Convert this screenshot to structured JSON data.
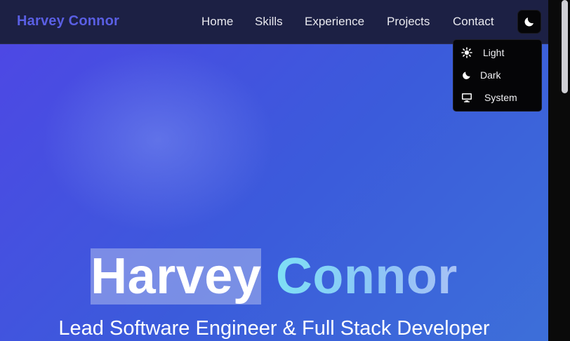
{
  "nav": {
    "brand": "Harvey Connor",
    "links": [
      "Home",
      "Skills",
      "Experience",
      "Projects",
      "Contact"
    ],
    "theme_icon": "moon-icon"
  },
  "theme_menu": {
    "items": [
      {
        "label": "Light",
        "icon": "sun-icon"
      },
      {
        "label": "Dark",
        "icon": "moon-icon"
      },
      {
        "label": "System",
        "icon": "monitor-icon"
      }
    ]
  },
  "hero": {
    "first_name": "Harvey",
    "last_name": "Connor",
    "subtitle": "Lead Software Engineer & Full Stack Developer"
  },
  "colors": {
    "brand": "#5a5fe4",
    "navbar_bg": "#1c2044",
    "hero_bg_start": "#4f46e5",
    "hero_bg_end": "#3d6fd9",
    "menu_bg": "#050507",
    "accent_gradient_start": "#7ee0f5"
  }
}
